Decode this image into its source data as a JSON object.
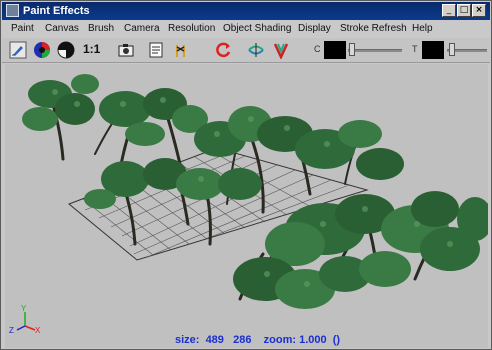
{
  "window": {
    "title": "Paint Effects",
    "minimize": "_",
    "maximize": "□",
    "close": "×"
  },
  "menu": [
    "Paint",
    "Canvas",
    "Brush",
    "Camera",
    "Resolution",
    "Object Shading",
    "Display",
    "Stroke Refresh",
    "Help"
  ],
  "toolbar": {
    "ratio_label": "1:1",
    "color_label": "C",
    "transparency_label": "T",
    "color_value": "#000000",
    "transparency_value": "#000000"
  },
  "viewport": {
    "status": "size:  489   286    zoom: 1.000  ()",
    "axes": {
      "x": "X",
      "y": "Y",
      "z": "Z"
    }
  },
  "colors": {
    "title_bar": "#0b3a8c",
    "status_text": "#1b2fd0",
    "viewport_bg": "#c0c0c0",
    "foliage": "#2f6a3a"
  }
}
